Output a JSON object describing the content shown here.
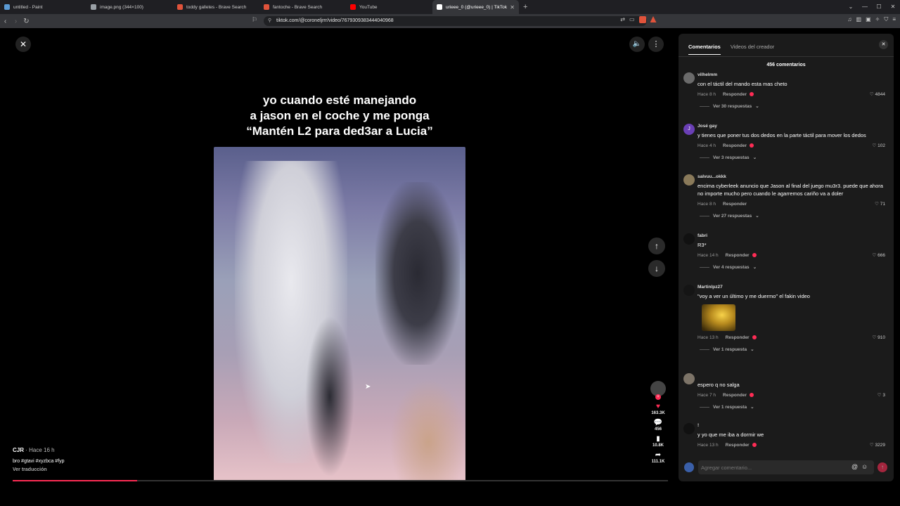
{
  "browser": {
    "tabs": [
      {
        "title": "untitled - Paint",
        "color": "#5b9bd5"
      },
      {
        "title": "image.png (344×100)",
        "color": "#9aa0a6"
      },
      {
        "title": "toddy galletes - Brave Search",
        "color": "#e0533b"
      },
      {
        "title": "fantoche - Brave Search",
        "color": "#e0533b"
      },
      {
        "title": "YouTube",
        "color": "#ff0000"
      },
      {
        "title": "urieee_0 (@urieee_0) | TikTok",
        "color": "#ffffff"
      }
    ],
    "active_tab": 5,
    "new_tab": "+",
    "url": "tiktok.com/@coroneljrrr/video/7679309383444040968"
  },
  "video": {
    "caption_lines": [
      "yo cuando esté manejando",
      "a jason en el coche y me ponga",
      "“Mantén L2 para ded3ar a Lucia”"
    ],
    "author": "CJR",
    "posted": " · Hace 16 h",
    "description": "bro #gtavi #xyzbca #fyp",
    "translate": "Ver traducción",
    "likes": "163.3K",
    "comments": "456",
    "saves": "10.8K",
    "shares": "111.1K",
    "progress_fraction": 0.19
  },
  "panel": {
    "tab_comments": "Comentarios",
    "tab_creator": "Videos del creador",
    "count": "456 comentarios",
    "input_placeholder": "Agregar comentario...",
    "reply_label": "Responder",
    "comments": [
      {
        "user": "vilhelmm",
        "text": "con el táctil del mando esta mas cheto",
        "time": "Hace 8 h",
        "likes": "4844",
        "replies": "Ver 30 respuestas",
        "avatar": "#6b6b6b"
      },
      {
        "user": "José gay",
        "text": "y tienes que poner tus dos dedos en la parte táctil para mover los dedos",
        "time": "Hace 4 h",
        "likes": "102",
        "replies": "Ver 3 respuestas",
        "avatar": "#6a3fb5",
        "initial": "J"
      },
      {
        "user": "salvuu...okkk",
        "text": "encima cyberleek anuncio que Jason al final del juego mu3r3. puede que ahora no importe mucho pero cuando le agarremos cariño va a doler",
        "time": "Hace 8 h",
        "likes": "71",
        "replies": "Ver 27 respuestas",
        "avatar": "#8a7a5a"
      },
      {
        "user": "fabri",
        "text": "R3*",
        "time": "Hace 14 h",
        "likes": "666",
        "replies": "Ver 4 respuestas",
        "avatar": "#111111"
      },
      {
        "user": "Martinlpz27",
        "text": "\"voy a ver un último y me duermo\" el fakin video",
        "time": "Hace 13 h",
        "likes": "910",
        "replies": "Ver 1 respuesta",
        "avatar": "#151515"
      },
      {
        "user": "",
        "text": "espero q no salga",
        "time": "Hace 7 h",
        "likes": "3",
        "replies": "Ver 1 respuesta",
        "avatar": "#7d7468"
      },
      {
        "user": "!",
        "text": "y yo que me iba a dormir we",
        "time": "Hace 13 h",
        "likes": "3229",
        "replies": "",
        "avatar": "#111111"
      }
    ]
  }
}
